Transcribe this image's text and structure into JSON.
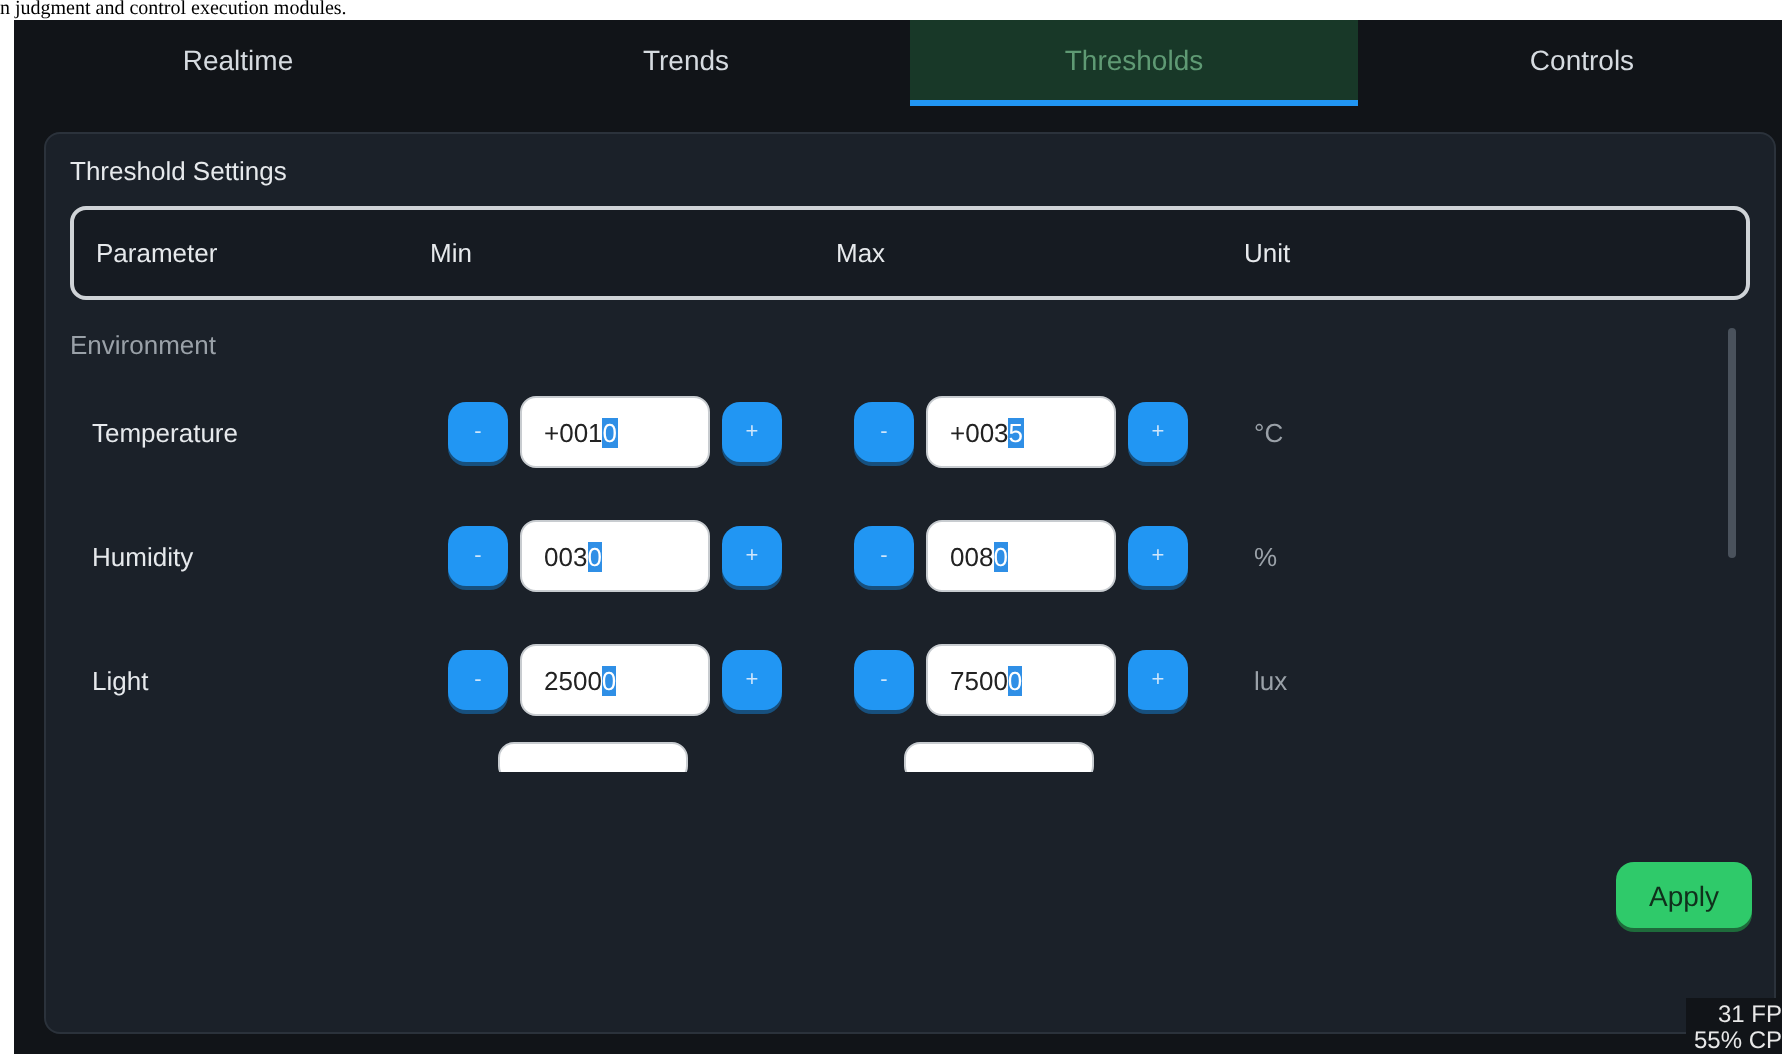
{
  "caption": "n judgment and control execution modules.",
  "tabs": [
    {
      "label": "Realtime",
      "selected": false
    },
    {
      "label": "Trends",
      "selected": false
    },
    {
      "label": "Thresholds",
      "selected": true
    },
    {
      "label": "Controls",
      "selected": false
    }
  ],
  "panel": {
    "title": "Threshold Settings",
    "columns": [
      "Parameter",
      "Min",
      "Max",
      "Unit"
    ],
    "group": "Environment",
    "rows": [
      {
        "name": "Temperature",
        "min": {
          "decrement": "-",
          "value": "+001",
          "selected_text": "0",
          "increment": "+"
        },
        "max": {
          "decrement": "-",
          "value": "+003",
          "selected_text": "5",
          "increment": "+"
        },
        "unit": "°C"
      },
      {
        "name": "Humidity",
        "min": {
          "decrement": "-",
          "value": "003",
          "selected_text": "0",
          "increment": "+"
        },
        "max": {
          "decrement": "-",
          "value": "008",
          "selected_text": "0",
          "increment": "+"
        },
        "unit": "%"
      },
      {
        "name": "Light",
        "min": {
          "decrement": "-",
          "value": "2500",
          "selected_text": "0",
          "increment": "+"
        },
        "max": {
          "decrement": "-",
          "value": "7500",
          "selected_text": "0",
          "increment": "+"
        },
        "unit": "lux"
      }
    ],
    "more_rows_below": true,
    "apply_button": "Apply"
  },
  "overlay": [
    "31 FP",
    "55% CP"
  ]
}
